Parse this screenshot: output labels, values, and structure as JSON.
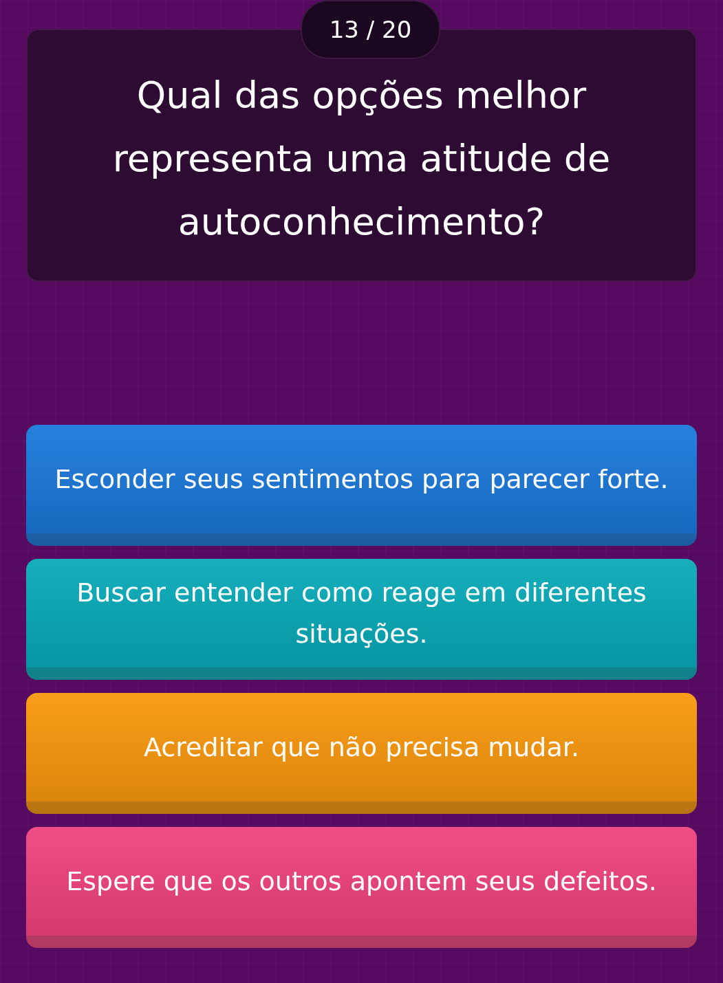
{
  "counter": "13 / 20",
  "question": "Qual das opções melhor representa uma atitude de autoconhecimento?",
  "options": [
    {
      "text": "Esconder seus sentimentos para parecer forte.",
      "color": "#1a78db"
    },
    {
      "text": "Buscar entender como reage em diferentes situações.",
      "color": "#08aab8"
    },
    {
      "text": "Acreditar que não precisa mudar.",
      "color": "#f9980c"
    },
    {
      "text": "Espere que os outros apontem seus defeitos.",
      "color": "#f0427e"
    }
  ]
}
